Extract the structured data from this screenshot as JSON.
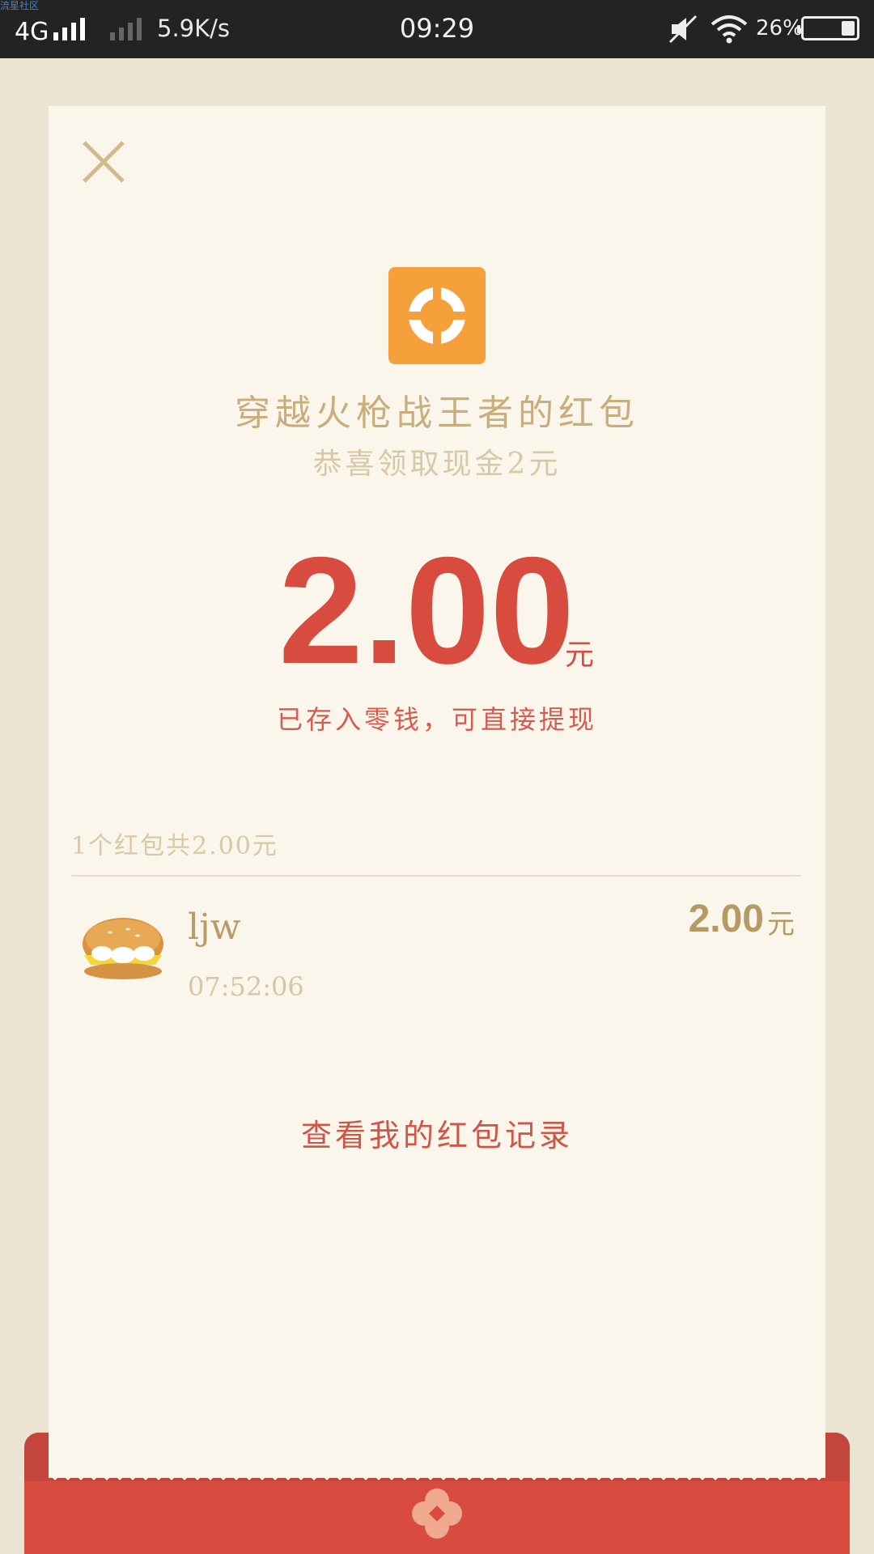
{
  "watermark": "流星社区",
  "status_bar": {
    "network": "4G",
    "speed": "5.9K/s",
    "time": "09:29",
    "battery": "26%"
  },
  "red_packet": {
    "sender_title": "穿越火枪战王者的红包",
    "greeting": "恭喜领取现金2元",
    "amount": "2.00",
    "amount_unit": "元",
    "deposit_note": "已存入零钱，可直接提现",
    "summary": "1个红包共2.00元",
    "recipients": [
      {
        "name": "ljw",
        "time": "07:52:06",
        "amount": "2.00",
        "unit": "元"
      }
    ],
    "history_link": "查看我的红包记录"
  },
  "colors": {
    "accent_red": "#d84c40",
    "gold": "#c9ad7c",
    "card_bg": "#fbf6ec",
    "logo_orange": "#f5a03a"
  },
  "icons": {
    "close": "close-icon",
    "app_logo": "crossfire-logo-icon",
    "avatar": "burger-avatar",
    "emblem": "flower-emblem-icon"
  }
}
